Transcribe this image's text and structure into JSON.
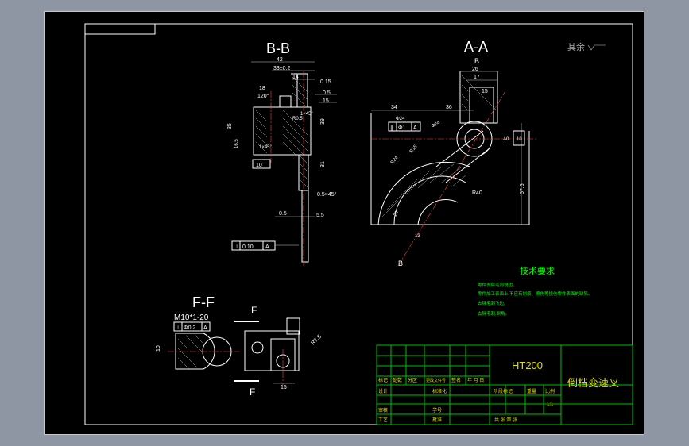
{
  "views": {
    "bb": {
      "title": "B-B",
      "dims": [
        "42",
        "33±0.2",
        "14",
        "18",
        "120°",
        "0.15",
        "0.5",
        "1×45°",
        "R0.5",
        "15",
        "39",
        "35",
        "16.5",
        "1×45°",
        "10",
        "31",
        "0.5×45°",
        "0.5",
        "5.5"
      ],
      "tolerance": [
        "⊥",
        "0.10",
        "A"
      ]
    },
    "aa": {
      "title": "A-A",
      "section_letter": "B",
      "dims": [
        "26",
        "17",
        "15",
        "34",
        "36",
        "Φ24",
        "Φ24",
        "R24",
        "R15",
        "A0",
        "10",
        "R40",
        "67.5",
        "20",
        "13"
      ],
      "tolerance": [
        "∥",
        "Φ1",
        "A"
      ],
      "cut_letter": "B"
    },
    "ff": {
      "title": "F-F",
      "thread": "M10*1-20",
      "tolerance": [
        "⊥",
        "Φ0.2",
        "A"
      ],
      "dims": [
        "10",
        "R7.5",
        "15"
      ],
      "cut_letter_top": "F",
      "cut_letter_bottom": "F"
    }
  },
  "surface_note": "其余",
  "tech_requirements": {
    "title": "技术要求",
    "items": [
      "零件去除毛刺锐边。",
      "零件加工表面上,不应有划痕、擦伤等损伤零件表面的缺陷。",
      "去除毛刺飞边。",
      "去除毛刺,倒角。"
    ]
  },
  "title_block": {
    "material": "HT200",
    "part_name": "倒档变速叉",
    "labels": {
      "mark": "标记",
      "count": "处数",
      "zone": "分区",
      "change_doc": "更改文件号",
      "sign": "签名",
      "date": "年 月 日",
      "design": "设计",
      "standardize": "标准化",
      "review": "审核",
      "process": "工艺",
      "approve": "批准",
      "school": "学号",
      "stage": "阶段标记",
      "weight": "重量",
      "scale": "比例",
      "scale_value": "1:1",
      "sheet_total": "共 张 第 张"
    }
  }
}
